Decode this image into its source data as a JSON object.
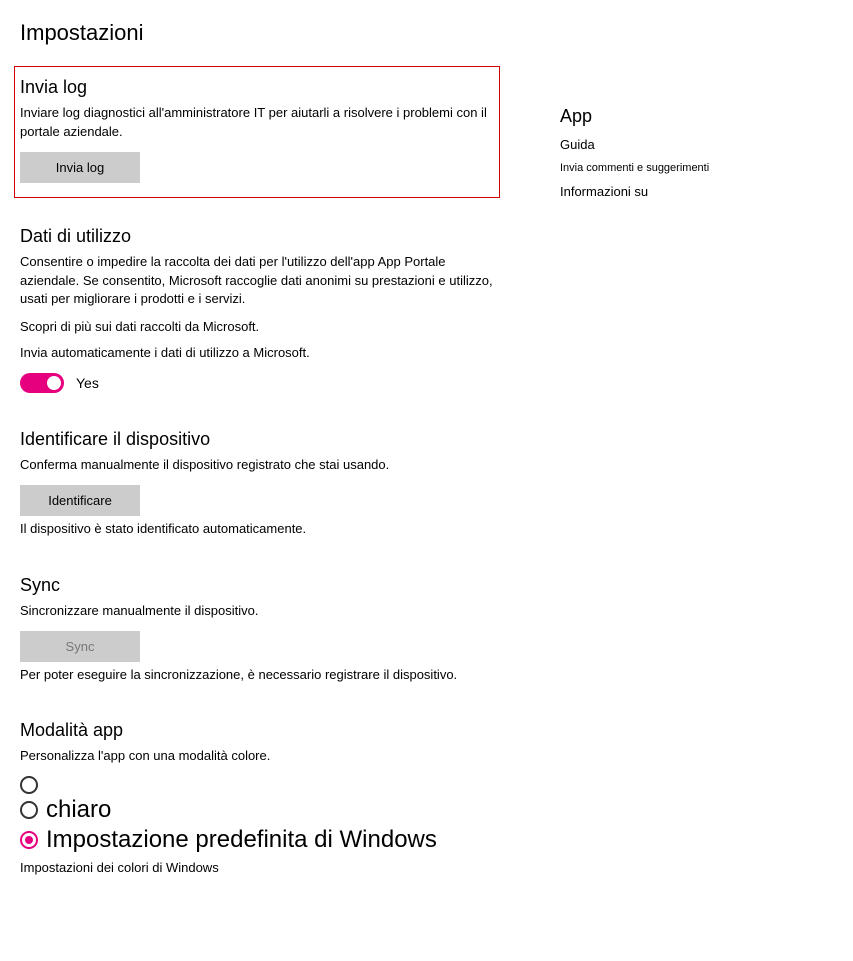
{
  "page_title": "Impostazioni",
  "send_logs": {
    "title": "Invia log",
    "desc": "Inviare log diagnostici all'amministratore IT per aiutarli a risolvere i problemi con il portale aziendale.",
    "button": "Invia log"
  },
  "usage_data": {
    "title": "Dati di utilizzo",
    "desc": "Consentire o impedire la raccolta dei dati per l'utilizzo dell'app App Portale aziendale. Se consentito, Microsoft raccoglie dati anonimi su prestazioni e utilizzo, usati per migliorare i prodotti e i servizi.",
    "learn_more": "Scopri di più sui dati raccolti da Microsoft.",
    "toggle_desc": "Invia automaticamente i dati di utilizzo a Microsoft.",
    "toggle_value": "Yes"
  },
  "identify_device": {
    "title": "Identificare il dispositivo",
    "desc": "Conferma manualmente il dispositivo registrato che stai usando.",
    "button": "Identificare",
    "status": "Il dispositivo è stato identificato automaticamente."
  },
  "sync": {
    "title": "Sync",
    "desc": "Sincronizzare manualmente il dispositivo.",
    "button": "Sync",
    "status": "Per poter eseguire la sincronizzazione, è necessario registrare il dispositivo."
  },
  "app_mode": {
    "title": "Modalità app",
    "desc": "Personalizza l'app con una modalità colore.",
    "options": {
      "empty": "",
      "light": "chiaro",
      "default": "Impostazione predefinita di Windows"
    },
    "sub_link": "Impostazioni dei colori di Windows"
  },
  "sidebar": {
    "heading": "App",
    "links": {
      "guide": "Guida",
      "feedback": "Invia commenti e suggerimenti",
      "about": "Informazioni su"
    }
  }
}
